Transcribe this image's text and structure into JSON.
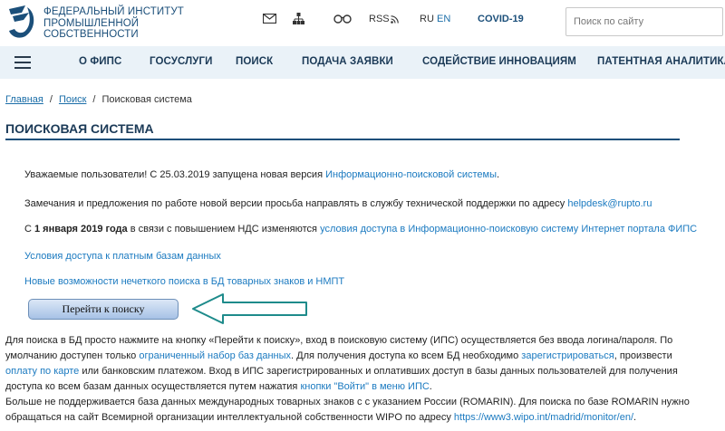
{
  "header": {
    "logo_lines": [
      "Федеральный институт",
      "промышленной",
      "собственности"
    ],
    "icons": [
      "mail-icon",
      "sitemap-icon",
      "glasses-icon"
    ],
    "rss_label": "RSS",
    "lang_ru": "RU",
    "lang_en": "EN",
    "covid_label": "COVID-19",
    "search_placeholder": "Поиск по сайту"
  },
  "nav": {
    "items": [
      "О ФИПС",
      "Госуслуги",
      "Поиск",
      "Подача заявки",
      "Содействие инновациям",
      "Патентная аналитика"
    ]
  },
  "breadcrumb": {
    "home": "Главная",
    "search": "Поиск",
    "current": "Поисковая система"
  },
  "page": {
    "title": "Поисковая система",
    "p1_text": "Уважаемые пользователи! С 25.03.2019 запущена новая версия ",
    "p1_link": "Информационно-поисковой системы",
    "p1_end": ".",
    "p2_text": "Замечания и предложения по работе новой версии просьба направлять в службу технической поддержки по адресу ",
    "p2_link": "helpdesk@rupto.ru",
    "p3_start": "С ",
    "p3_bold": "1 января 2019 года",
    "p3_text": " в связи с повышением НДС изменяются ",
    "p3_link": "условия доступа в Информационно-поисковую систему Интернет портала ФИПС",
    "link_paid": "Условия доступа к платным базам данных",
    "link_fuzzy": "Новые возможности нечеткого поиска в БД товарных знаков и НМПТ",
    "go_button": "Перейти к поиску",
    "b1": "Для поиска в БД просто нажмите на кнопку «Перейти к поиску», вход в поисковую систему (ИПС) осуществляется без ввода логина/пароля. По",
    "b2a": "умолчанию доступен только ",
    "b2_link1": "ограниченный набор баз данных",
    "b2b": ". Для получения доступа ко всем БД необходимо ",
    "b2_link2": "зарегистрироваться",
    "b2c": ", произвести",
    "b3_link": "оплату по карте",
    "b3a": " или банковским платежом. Вход в ИПС зарегистрированных и оплативших доступ в базы данных пользователей для получения",
    "b4a": "доступа ко всем базам данных осуществляется путем нажатия ",
    "b4_link": "кнопки \"Войти\" в меню ИПС",
    "b4b": ".",
    "b5": "Больше не поддерживается база данных международных товарных знаков с с указанием России (ROMARIN). Для поиска по базе ROMARIN нужно",
    "b6a": "обращаться на сайт Всемирной организации интеллектуальной собственности WIPO по адресу ",
    "b6_link": "https://www3.wipo.int/madrid/monitor/en/",
    "b6b": "."
  },
  "colors": {
    "brand": "#1b4f7a",
    "link": "#1b7ac0",
    "nav_bg": "#eaf2f8",
    "arrow": "#1e8b8b"
  }
}
